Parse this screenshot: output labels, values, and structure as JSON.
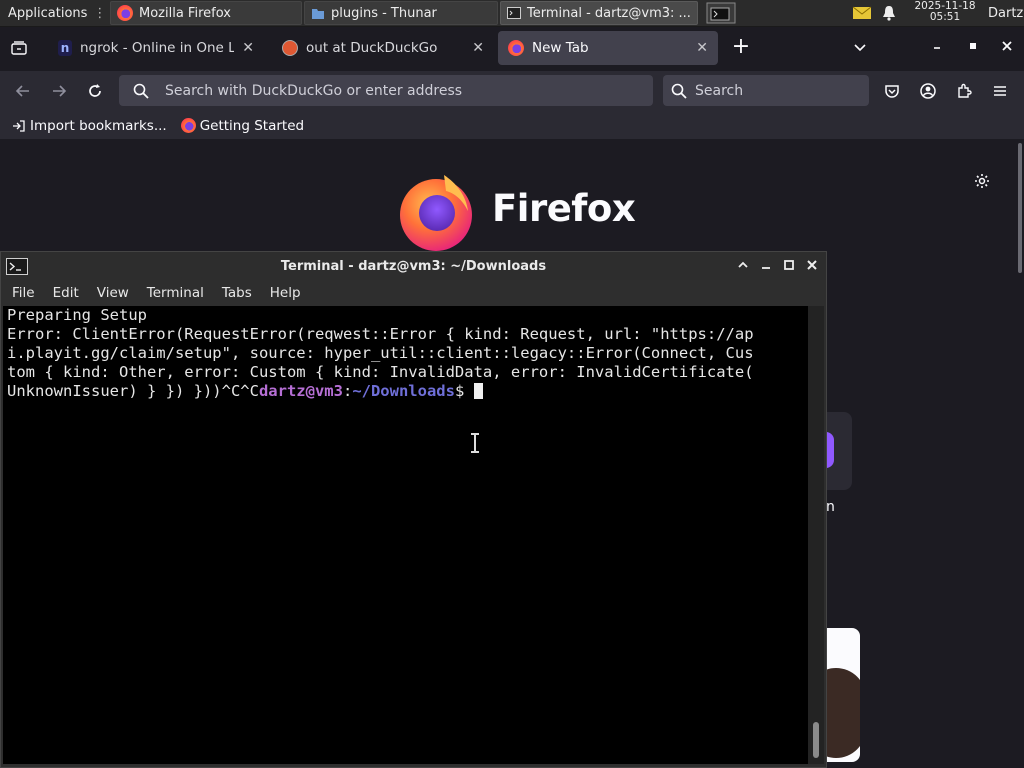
{
  "panel": {
    "applications_label": "Applications",
    "tasks": [
      {
        "label": "Mozilla Firefox"
      },
      {
        "label": "plugins - Thunar"
      },
      {
        "label": "Terminal - dartz@vm3: ..."
      }
    ],
    "date": "2025-11-18",
    "time": "05:51",
    "user": "Dartz"
  },
  "browser": {
    "tabs": [
      {
        "label": "ngrok - Online in One Line"
      },
      {
        "label": "out at DuckDuckGo"
      },
      {
        "label": "New Tab"
      }
    ],
    "url_placeholder": "Search with DuckDuckGo or enter address",
    "search_placeholder": "Search",
    "bookmarks": [
      {
        "label": "Import bookmarks..."
      },
      {
        "label": "Getting Started"
      }
    ],
    "brand": "Firefox",
    "shortcut_partial_label": "n"
  },
  "terminal": {
    "title": "Terminal - dartz@vm3: ~/Downloads",
    "menu": [
      "File",
      "Edit",
      "View",
      "Terminal",
      "Tabs",
      "Help"
    ],
    "lines": [
      "Preparing Setup",
      "",
      "Error: ClientError(RequestError(reqwest::Error { kind: Request, url: \"https://ap",
      "i.playit.gg/claim/setup\", source: hyper_util::client::legacy::Error(Connect, Cus",
      "tom { kind: Other, error: Custom { kind: InvalidData, error: InvalidCertificate(",
      "UnknownIssuer) } }) }))^C^C"
    ],
    "prompt_user": "dartz@vm3",
    "prompt_sep": ":",
    "prompt_path": "~/Downloads",
    "prompt_symbol": "$ "
  },
  "colors": {
    "prompt_user": "#b66fd5",
    "prompt_path": "#6f6fd8"
  }
}
